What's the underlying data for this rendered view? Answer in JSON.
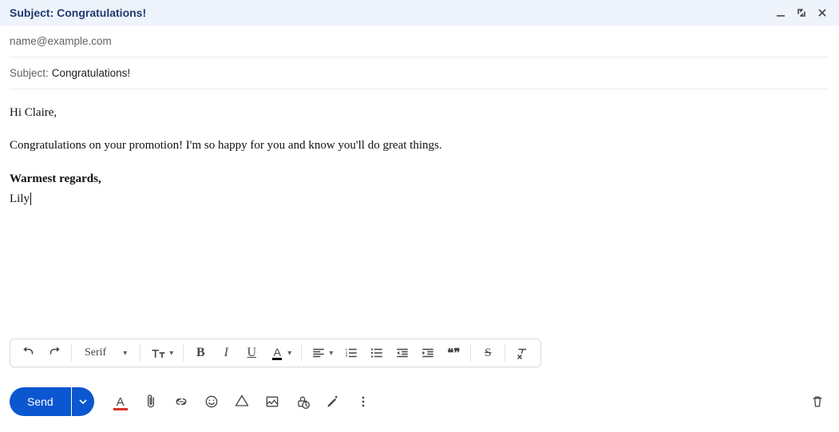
{
  "title_prefix": "Subject:",
  "title_subject": "Congratulations!",
  "to": "name@example.com",
  "subject_label": "Subject:",
  "subject_value": "Congratulations!",
  "body": {
    "greeting": "Hi Claire,",
    "p1": "Congratulations on your promotion! I'm so happy for you and know you'll do great things.",
    "signoff": "Warmest regards,",
    "signature": "Lily"
  },
  "format": {
    "font_name": "Serif",
    "size_label": "Tᴛ",
    "bold": "B",
    "italic": "I",
    "underline": "U",
    "color": "A",
    "strike": "S",
    "quote": "❝❞"
  },
  "send_label": "Send"
}
